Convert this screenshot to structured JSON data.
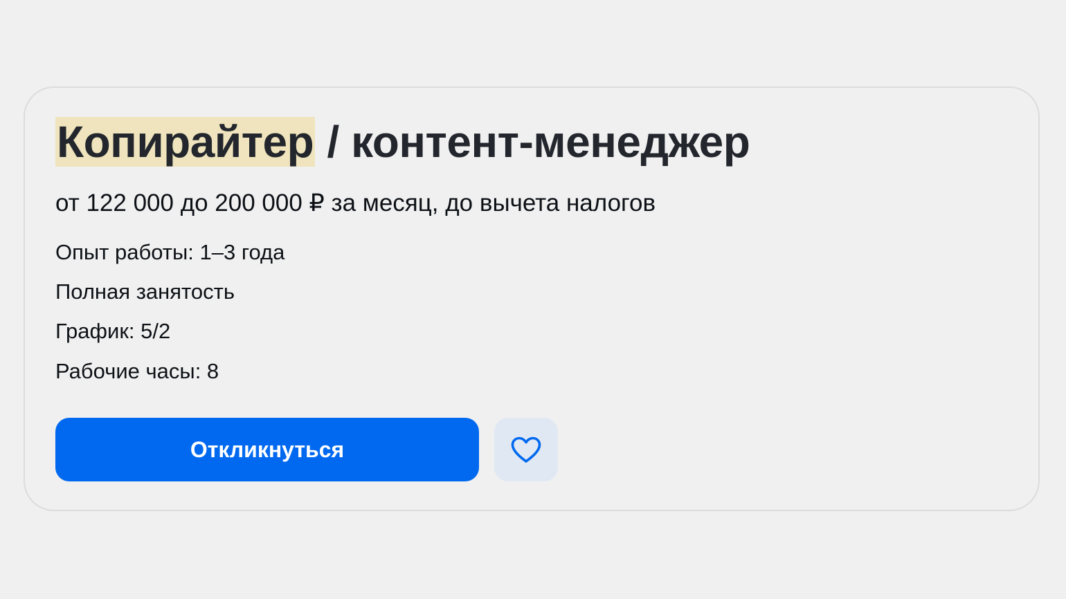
{
  "vacancy": {
    "title_highlight": "Копирайтер",
    "title_rest": " / контент-менеджер",
    "salary": "от 122 000 до 200 000 ₽ за месяц, до вычета налогов",
    "details": [
      "Опыт работы: 1–3 года",
      "Полная занятость",
      "График: 5/2",
      "Рабочие часы: 8"
    ],
    "apply_label": "Откликнуться",
    "favorite_icon": "heart-icon"
  },
  "colors": {
    "accent": "#0069f0",
    "highlight": "#efe4bd",
    "favorite_bg": "#e0e8f3"
  }
}
